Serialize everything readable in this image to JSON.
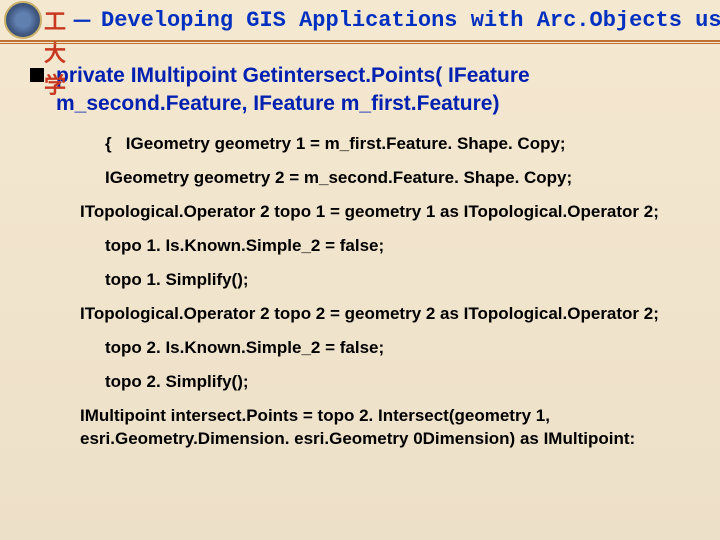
{
  "header": {
    "university": "西理工大学",
    "dash": "－",
    "course": "Developing GIS Applications with Arc.Objects using C#. NE"
  },
  "method": {
    "signature": "private IMultipoint Getintersect.Points( IFeature m_second.Feature, IFeature m_first.Feature)"
  },
  "code": {
    "line1": "IGeometry geometry 1 = m_first.Feature. Shape. Copy;",
    "line2": "IGeometry geometry 2 = m_second.Feature. Shape. Copy;",
    "line3": "ITopological.Operator 2 topo 1 = geometry 1 as ITopological.Operator 2;",
    "line4": "topo 1. Is.Known.Simple_2 = false;",
    "line5": "topo 1. Simplify();",
    "line6": "ITopological.Operator 2 topo 2 = geometry 2 as ITopological.Operator 2;",
    "line7": "topo 2. Is.Known.Simple_2 = false;",
    "line8": "topo 2. Simplify();",
    "line9": "IMultipoint intersect.Points = topo 2. Intersect(geometry 1, esri.Geometry.Dimension. esri.Geometry 0Dimension) as IMultipoint:"
  }
}
